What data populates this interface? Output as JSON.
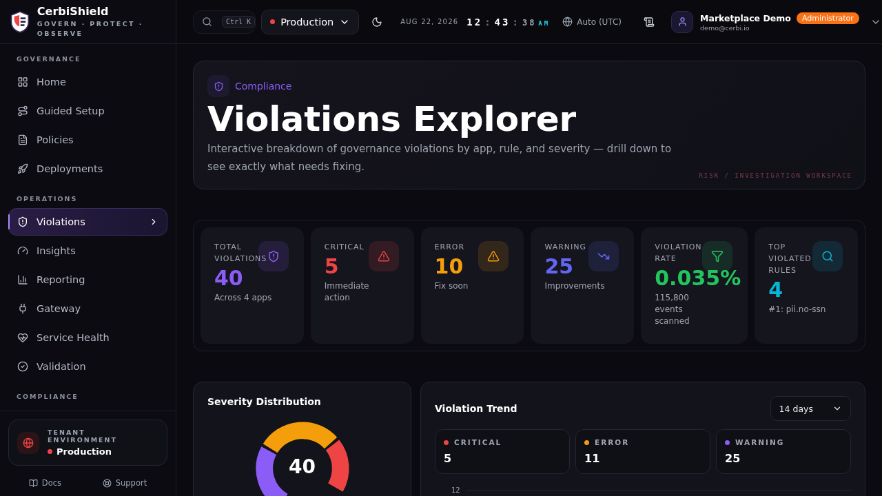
{
  "brand": {
    "name": "CerbiShield",
    "tagline": "GOVERN · PROTECT · OBSERVE"
  },
  "sidebar": {
    "sections": [
      {
        "title": "GOVERNANCE",
        "items": [
          {
            "label": "Home",
            "selected": false
          },
          {
            "label": "Guided Setup",
            "selected": false
          },
          {
            "label": "Policies",
            "selected": false
          },
          {
            "label": "Deployments",
            "selected": false
          }
        ]
      },
      {
        "title": "OPERATIONS",
        "items": [
          {
            "label": "Violations",
            "selected": true
          },
          {
            "label": "Insights",
            "selected": false
          },
          {
            "label": "Reporting",
            "selected": false
          },
          {
            "label": "Gateway",
            "selected": false
          },
          {
            "label": "Service Health",
            "selected": false
          },
          {
            "label": "Validation",
            "selected": false
          }
        ]
      },
      {
        "title": "COMPLIANCE"
      }
    ]
  },
  "tenant": {
    "label": "TENANT ENVIRONMENT",
    "value": "Production",
    "color": "#ef4444"
  },
  "footer_links": [
    {
      "label": "Docs"
    },
    {
      "label": "Support"
    }
  ],
  "topbar": {
    "search_shortcut": "Ctrl K",
    "environment": {
      "label": "Production",
      "color": "#ef4444"
    },
    "date": "AUG 22, 2026",
    "clock": [
      {
        "text": "12",
        "kind": "major"
      },
      {
        "text": ":",
        "kind": "sep"
      },
      {
        "text": "43",
        "kind": "major"
      },
      {
        "text": ":",
        "kind": "sep"
      },
      {
        "text": "38",
        "kind": "minor"
      },
      {
        "text": "AM",
        "kind": "period"
      }
    ],
    "timezone": "Auto (UTC)",
    "user": {
      "name": "Marketplace Demo",
      "role": "Administrator",
      "email": "demo@cerbi.io"
    }
  },
  "hero": {
    "breadcrumb": "Compliance",
    "title": "Violations Explorer",
    "subtitle": "Interactive breakdown of governance violations by app, rule, and severity — drill down to see exactly what needs fixing.",
    "tag": "RISK / INVESTIGATION WORKSPACE"
  },
  "stats": [
    {
      "label": "TOTAL VIOLATIONS",
      "value": "40",
      "note": "Across 4 apps",
      "color": "#8b5cf6"
    },
    {
      "label": "CRITICAL",
      "value": "5",
      "note": "Immediate action",
      "color": "#ef4444"
    },
    {
      "label": "ERROR",
      "value": "10",
      "note": "Fix soon",
      "color": "#f59e0b"
    },
    {
      "label": "WARNING",
      "value": "25",
      "note": "Improvements",
      "color": "#6366f1"
    },
    {
      "label": "VIOLATION RATE",
      "value": "0.035%",
      "note": "115,800 events scanned",
      "color": "#22c55e"
    },
    {
      "label": "TOP VIOLATED RULES",
      "value": "4",
      "note": "#1: pii.no-ssn",
      "color": "#06b6d4"
    }
  ],
  "severity": {
    "title": "Severity Distribution",
    "total": "40"
  },
  "trend": {
    "title": "Violation Trend",
    "range": "14 days",
    "legend": [
      {
        "label": "CRITICAL",
        "value": "5",
        "color": "#ef4444"
      },
      {
        "label": "ERROR",
        "value": "11",
        "color": "#f59e0b"
      },
      {
        "label": "WARNING",
        "value": "25",
        "color": "#8b5cf6"
      }
    ],
    "top_tick": "12"
  }
}
